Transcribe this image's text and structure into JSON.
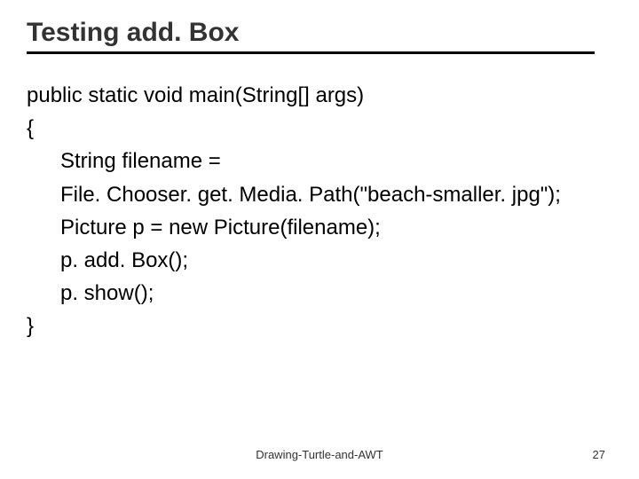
{
  "title": "Testing add. Box",
  "code": {
    "l1": "public static void main(String[] args)",
    "l2": "{",
    "l3": "String filename =",
    "l4": "File. Chooser. get. Media. Path(\"beach-smaller. jpg\");",
    "l5": "Picture p = new Picture(filename);",
    "l6": "p. add. Box();",
    "l7": "p. show();",
    "l8": "}"
  },
  "footer": "Drawing-Turtle-and-AWT",
  "page": "27"
}
